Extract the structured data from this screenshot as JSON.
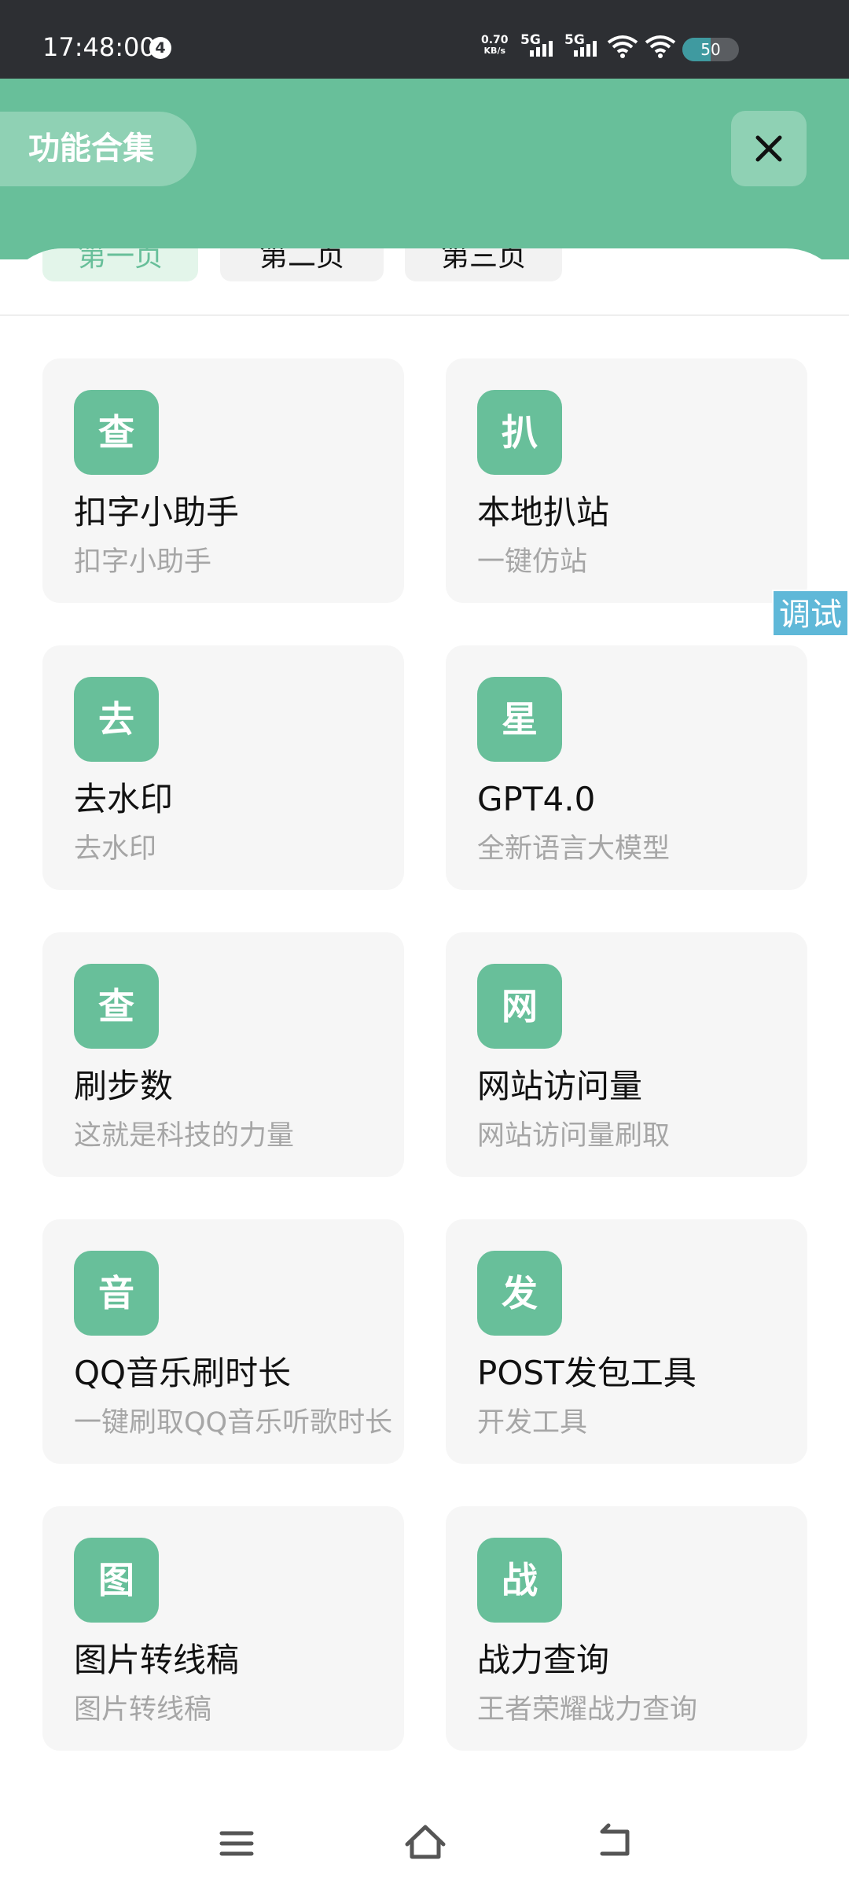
{
  "status_bar": {
    "time": "17:48:00",
    "notification_count": "4",
    "net_speed_value": "0.70",
    "net_speed_unit": "KB/s",
    "signal1_label": "5G",
    "signal2_label": "5G",
    "battery": "50",
    "battery_level": 0.5
  },
  "header": {
    "title": "功能合集",
    "close_icon": "close-icon",
    "accent_color": "#68bf9a"
  },
  "tabs": [
    {
      "label": "第一页",
      "active": true
    },
    {
      "label": "第二页",
      "active": false
    },
    {
      "label": "第三页",
      "active": false
    }
  ],
  "cards": [
    {
      "icon": "查",
      "title": "扣字小助手",
      "subtitle": "扣字小助手"
    },
    {
      "icon": "扒",
      "title": "本地扒站",
      "subtitle": "一键仿站"
    },
    {
      "icon": "去",
      "title": "去水印",
      "subtitle": "去水印"
    },
    {
      "icon": "星",
      "title": "GPT4.0",
      "subtitle": "全新语言大模型"
    },
    {
      "icon": "查",
      "title": "刷步数",
      "subtitle": "这就是科技的力量"
    },
    {
      "icon": "网",
      "title": "网站访问量",
      "subtitle": "网站访问量刷取"
    },
    {
      "icon": "音",
      "title": "QQ音乐刷时长",
      "subtitle": "一键刷取QQ音乐听歌时长"
    },
    {
      "icon": "发",
      "title": "POST发包工具",
      "subtitle": "开发工具"
    },
    {
      "icon": "图",
      "title": "图片转线稿",
      "subtitle": "图片转线稿"
    },
    {
      "icon": "战",
      "title": "战力查询",
      "subtitle": "王者荣耀战力查询"
    }
  ],
  "debug_tag": "调试",
  "navbar": {
    "menu_icon": "menu-icon",
    "home_icon": "home-icon",
    "back_icon": "back-icon"
  }
}
